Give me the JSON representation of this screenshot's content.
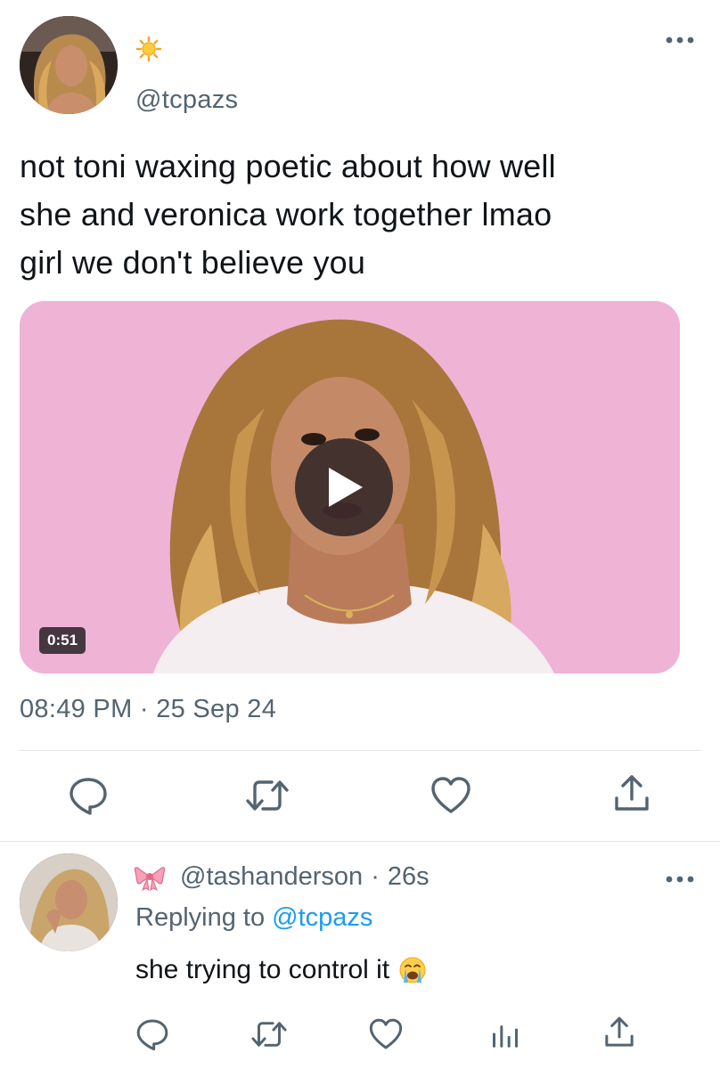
{
  "main_tweet": {
    "avatar": "profile-photo",
    "display_name_emoji": "sun-emoji",
    "handle": "@tcpazs",
    "more_icon": "more-horizontal-icon",
    "text_lines": [
      "not toni waxing poetic about how well",
      "she and veronica work together lmao",
      "girl we don't believe you"
    ],
    "media": {
      "type": "video",
      "play_icon": "play-icon",
      "duration": "0:51"
    },
    "timestamp": "08:49 PM · 25 Sep 24",
    "actions": [
      {
        "name": "reply",
        "icon": "reply-icon"
      },
      {
        "name": "retweet",
        "icon": "retweet-icon"
      },
      {
        "name": "like",
        "icon": "heart-icon"
      },
      {
        "name": "share",
        "icon": "share-icon"
      }
    ]
  },
  "reply_tweet": {
    "avatar": "profile-photo",
    "display_name_emoji": "ribbon-emoji",
    "handle": "@tashanderson",
    "separator": "·",
    "time_ago": "26s",
    "more_icon": "more-horizontal-icon",
    "replying_prefix": "Replying to",
    "replying_to": "@tcpazs",
    "text": "she trying to control it",
    "text_emoji": "loudly-crying-face-emoji",
    "actions": [
      {
        "name": "reply",
        "icon": "reply-icon"
      },
      {
        "name": "retweet",
        "icon": "retweet-icon"
      },
      {
        "name": "like",
        "icon": "heart-icon"
      },
      {
        "name": "views",
        "icon": "views-icon"
      },
      {
        "name": "share",
        "icon": "share-icon"
      }
    ]
  },
  "colors": {
    "text_primary": "#0f1419",
    "text_secondary": "#536471",
    "link_blue": "#1d9bf0",
    "media_background": "#efb3d6",
    "divider": "#e3e7ea"
  }
}
